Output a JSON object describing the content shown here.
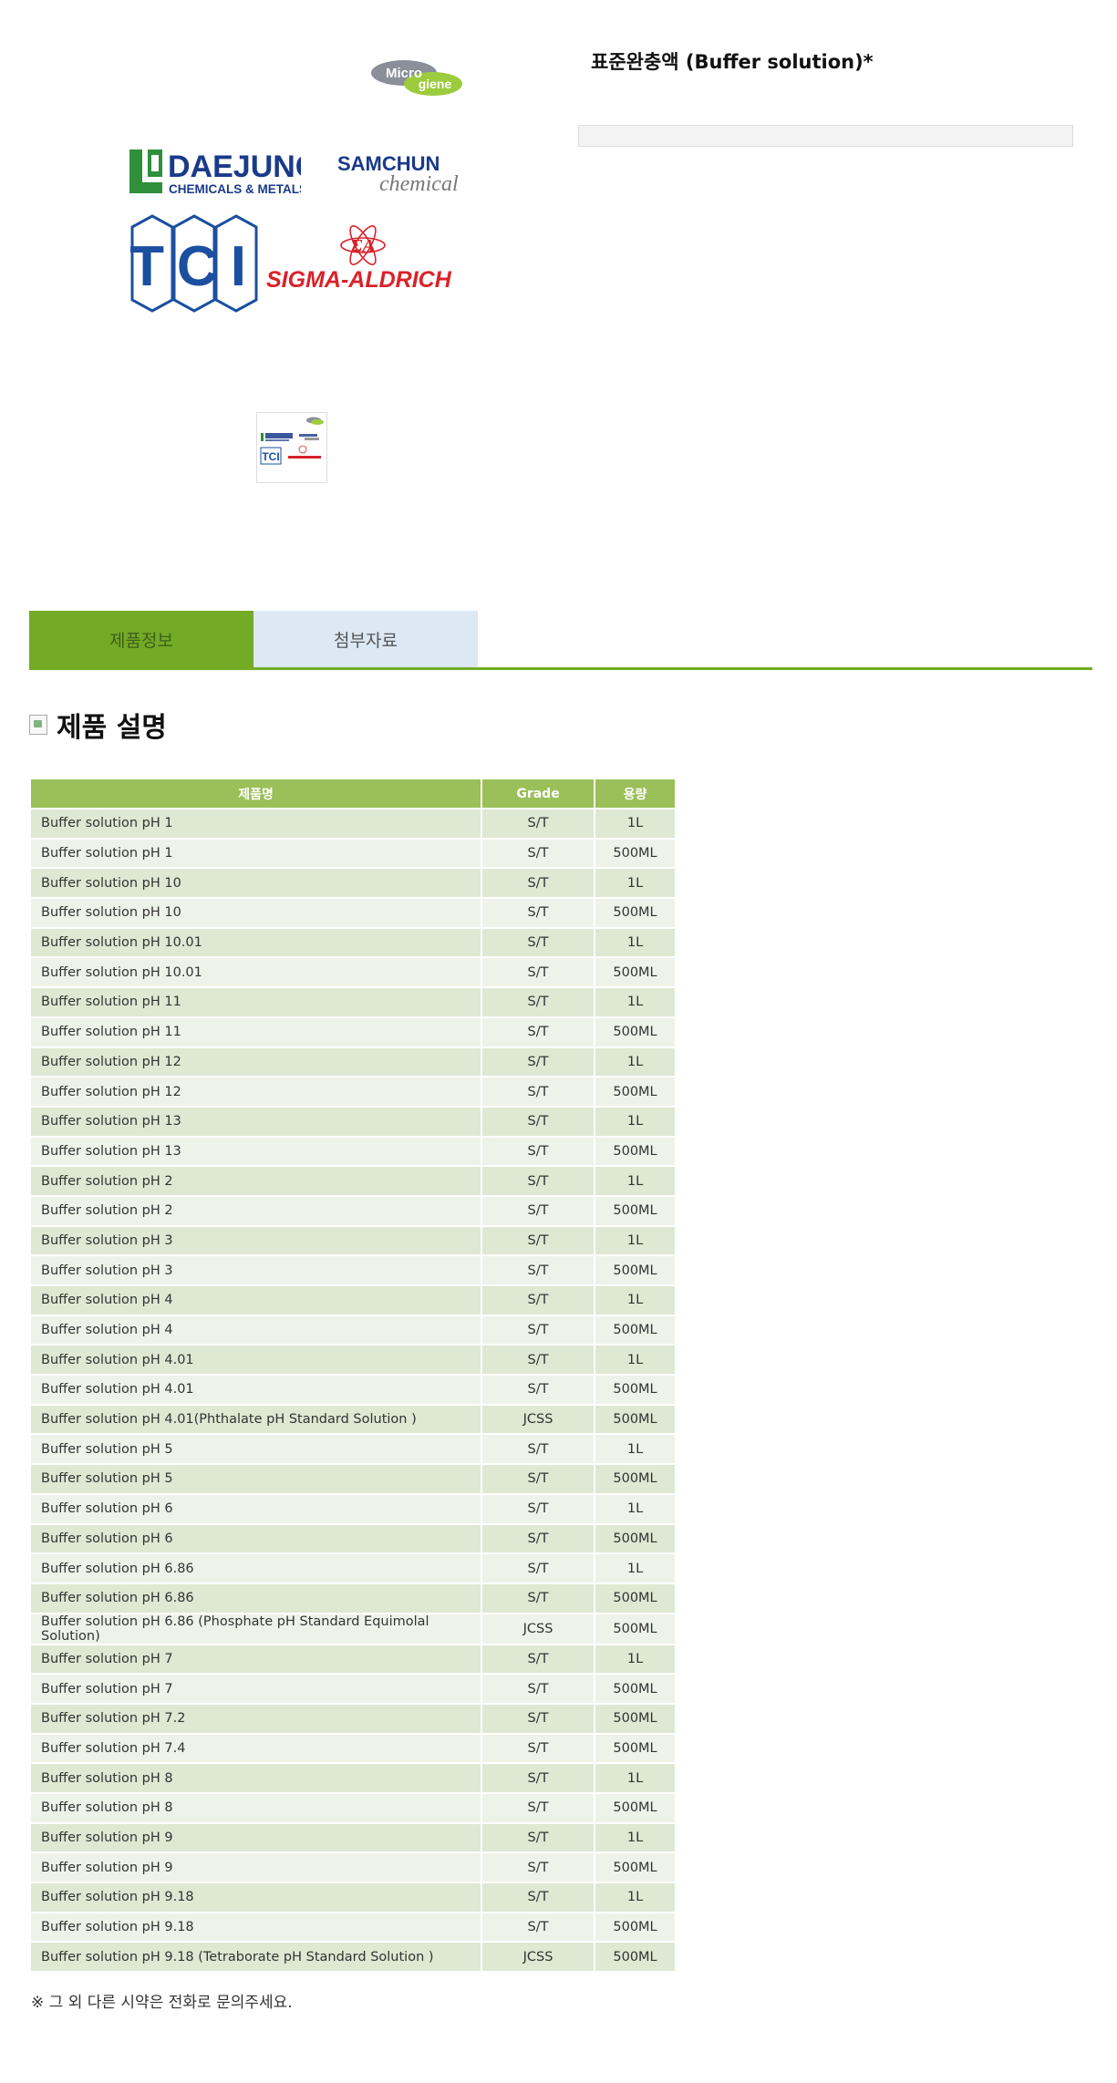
{
  "logos": {
    "microgiene_top": "Micro",
    "microgiene_bottom": "giene",
    "daejung_main": "DAEJUNG",
    "daejung_sub": "CHEMICALS & METALS",
    "samchun_main": "SAMCHUN",
    "samchun_sub": "chemical",
    "tci": "TCI",
    "sigma": "SIGMA-ALDRICH"
  },
  "product": {
    "title": "표준완충액 (Buffer solution)*"
  },
  "tabs": [
    {
      "label": "제품정보",
      "active": true
    },
    {
      "label": "첨부자료",
      "active": false
    }
  ],
  "section": {
    "heading": "제품 설명"
  },
  "table": {
    "headers": [
      "제품명",
      "Grade",
      "용량"
    ],
    "rows": [
      [
        "Buffer solution pH 1",
        "S/T",
        "1L"
      ],
      [
        "Buffer solution pH 1",
        "S/T",
        "500ML"
      ],
      [
        "Buffer solution pH 10",
        "S/T",
        "1L"
      ],
      [
        "Buffer solution pH 10",
        "S/T",
        "500ML"
      ],
      [
        "Buffer solution pH 10.01",
        "S/T",
        "1L"
      ],
      [
        "Buffer solution pH 10.01",
        "S/T",
        "500ML"
      ],
      [
        "Buffer solution pH 11",
        "S/T",
        "1L"
      ],
      [
        "Buffer solution pH 11",
        "S/T",
        "500ML"
      ],
      [
        "Buffer solution pH 12",
        "S/T",
        "1L"
      ],
      [
        "Buffer solution pH 12",
        "S/T",
        "500ML"
      ],
      [
        "Buffer solution pH 13",
        "S/T",
        "1L"
      ],
      [
        "Buffer solution pH 13",
        "S/T",
        "500ML"
      ],
      [
        "Buffer solution pH 2",
        "S/T",
        "1L"
      ],
      [
        "Buffer solution pH 2",
        "S/T",
        "500ML"
      ],
      [
        "Buffer solution pH 3",
        "S/T",
        "1L"
      ],
      [
        "Buffer solution pH 3",
        "S/T",
        "500ML"
      ],
      [
        "Buffer solution pH 4",
        "S/T",
        "1L"
      ],
      [
        "Buffer solution pH 4",
        "S/T",
        "500ML"
      ],
      [
        "Buffer solution pH 4.01",
        "S/T",
        "1L"
      ],
      [
        "Buffer solution pH 4.01",
        "S/T",
        "500ML"
      ],
      [
        "Buffer solution pH 4.01(Phthalate pH Standard Solution )",
        "JCSS",
        "500ML"
      ],
      [
        "Buffer solution pH 5",
        "S/T",
        "1L"
      ],
      [
        "Buffer solution pH 5",
        "S/T",
        "500ML"
      ],
      [
        "Buffer solution pH 6",
        "S/T",
        "1L"
      ],
      [
        "Buffer solution pH 6",
        "S/T",
        "500ML"
      ],
      [
        "Buffer solution pH 6.86",
        "S/T",
        "1L"
      ],
      [
        "Buffer solution pH 6.86",
        "S/T",
        "500ML"
      ],
      [
        "Buffer solution pH 6.86 (Phosphate pH Standard Equimolal Solution)",
        "JCSS",
        "500ML"
      ],
      [
        "Buffer solution pH 7",
        "S/T",
        "1L"
      ],
      [
        "Buffer solution pH 7",
        "S/T",
        "500ML"
      ],
      [
        "Buffer solution pH 7.2",
        "S/T",
        "500ML"
      ],
      [
        "Buffer solution pH 7.4",
        "S/T",
        "500ML"
      ],
      [
        "Buffer solution pH 8",
        "S/T",
        "1L"
      ],
      [
        "Buffer solution pH 8",
        "S/T",
        "500ML"
      ],
      [
        "Buffer solution pH 9",
        "S/T",
        "1L"
      ],
      [
        "Buffer solution pH 9",
        "S/T",
        "500ML"
      ],
      [
        "Buffer solution pH 9.18",
        "S/T",
        "1L"
      ],
      [
        "Buffer solution pH 9.18",
        "S/T",
        "500ML"
      ],
      [
        "Buffer solution pH 9.18 (Tetraborate pH Standard Solution )",
        "JCSS",
        "500ML"
      ]
    ]
  },
  "footnote": "※ 그 외 다른 시약은 전화로 문의주세요.",
  "colors": {
    "tab_active": "#73ab26",
    "tab_inactive": "#dce8f4",
    "table_header": "#9bbf59",
    "row_odd": "#dee8d3",
    "row_even": "#eef3ea",
    "daejung_blue": "#1a3a8a",
    "daejung_green": "#2f8f3a",
    "tci_blue": "#1b4fa0",
    "sigma_red": "#d9222a"
  }
}
